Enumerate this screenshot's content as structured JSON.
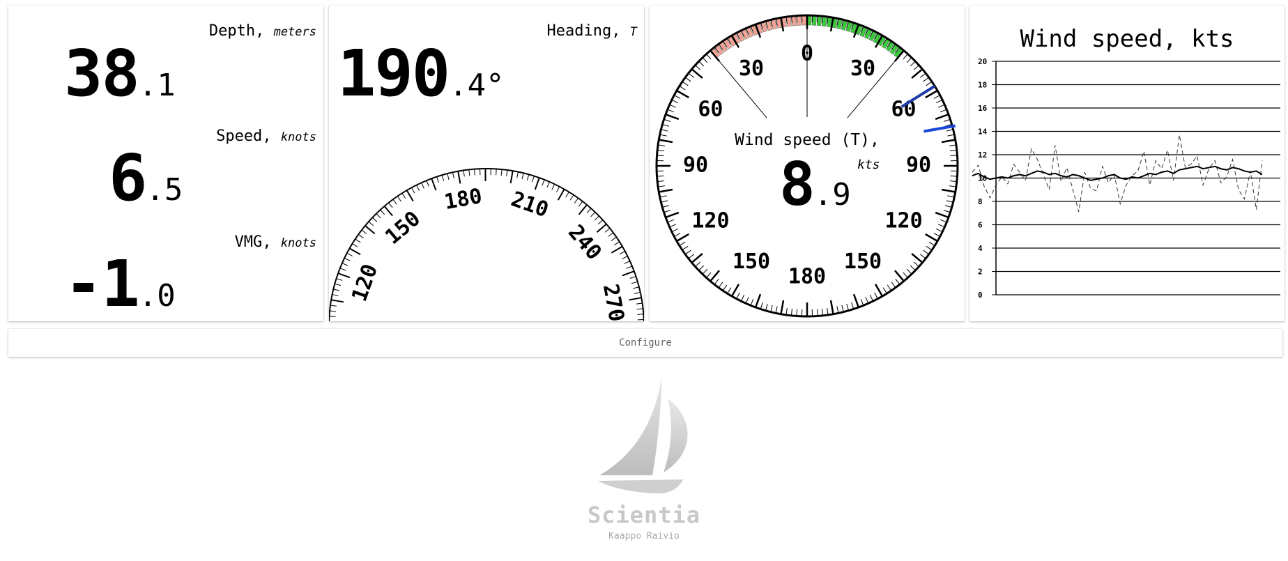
{
  "depth": {
    "label": "Depth",
    "unit": "meters",
    "int": "38",
    "frac": ".1"
  },
  "speed": {
    "label": "Speed",
    "unit": "knots",
    "int": "6",
    "frac": ".5"
  },
  "vmg": {
    "label": "VMG",
    "unit": "knots",
    "int": "-1",
    "frac": ".0"
  },
  "heading": {
    "label": "Heading",
    "unit": "T",
    "int": "190",
    "frac": ".4°",
    "dial_labels": [
      "120",
      "150",
      "180",
      "210",
      "240",
      "270"
    ]
  },
  "wind_dial": {
    "label": "Wind speed (T),",
    "unit": "kts",
    "int": "8",
    "frac": ".9",
    "angle_labels": [
      "0",
      "30",
      "60",
      "90",
      "120",
      "150",
      "180",
      "150",
      "120",
      "90",
      "60",
      "30"
    ],
    "port_color": "#f2a596",
    "starboard_color": "#3cc83c",
    "needle_color": "#1e3ca8"
  },
  "configure": {
    "label": "Configure"
  },
  "branding": {
    "name": "Scientia",
    "author": "Kaappo Raivio"
  },
  "chart_data": {
    "type": "line",
    "title": "Wind speed, kts",
    "ylim": [
      0,
      20
    ],
    "yticks": [
      "0",
      "2",
      "4",
      "6",
      "8",
      "10",
      "12",
      "14",
      "16",
      "18",
      "20"
    ],
    "grid": true,
    "series": [
      {
        "values": [
          10.2,
          10.4,
          10.1,
          9.9,
          10.0,
          10.1,
          10.0,
          10.2,
          10.3,
          10.2,
          10.4,
          10.6,
          10.5,
          10.3,
          10.4,
          10.2,
          10.1,
          10.3,
          10.2,
          10.0,
          9.8,
          9.9,
          10.0,
          10.2,
          10.3,
          10.0,
          9.9,
          10.1,
          10.0,
          10.2,
          10.4,
          10.3,
          10.5,
          10.6,
          10.4,
          10.7,
          10.8,
          10.9,
          11.0,
          10.8,
          10.9,
          11.0,
          10.8,
          10.7,
          10.9,
          10.8,
          10.6,
          10.5,
          10.6,
          10.3
        ]
      },
      {
        "values": [
          10.5,
          11.1,
          9.3,
          8.3,
          9.4,
          10.1,
          9.5,
          11.2,
          10.5,
          9.8,
          12.5,
          11.6,
          10.3,
          9.0,
          12.8,
          9.7,
          10.9,
          9.0,
          7.1,
          10.5,
          9.1,
          8.9,
          11.0,
          9.6,
          10.3,
          7.8,
          9.4,
          10.2,
          10.6,
          12.3,
          9.4,
          11.5,
          10.8,
          12.4,
          9.8,
          13.7,
          10.9,
          11.2,
          11.9,
          9.4,
          10.8,
          11.5,
          9.6,
          10.1,
          11.6,
          9.0,
          8.2,
          10.6,
          7.3,
          11.5
        ]
      }
    ]
  }
}
